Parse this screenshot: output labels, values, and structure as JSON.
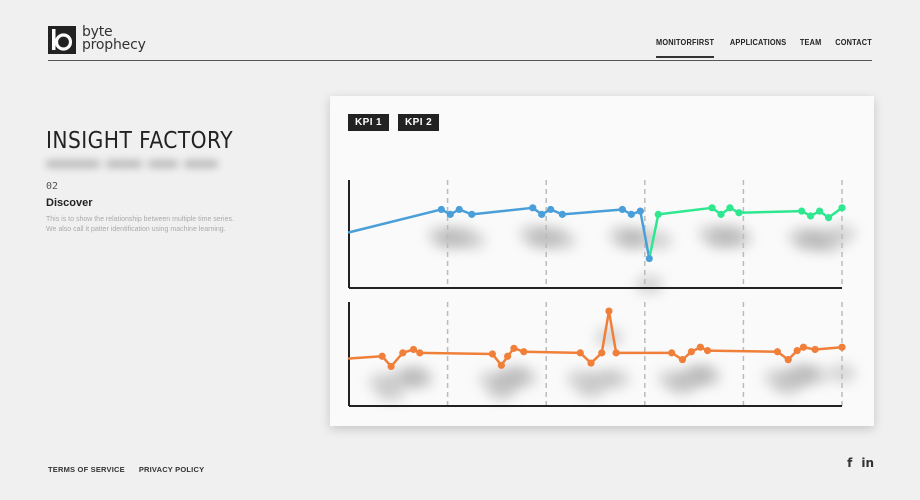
{
  "brand": {
    "line1": "byte",
    "line2": "prophecy"
  },
  "nav": [
    {
      "label": "MONITORFIRST",
      "active": true
    },
    {
      "label": "APPLICATIONS",
      "active": false
    },
    {
      "label": "TEAM",
      "active": false
    },
    {
      "label": "CONTACT",
      "active": false
    }
  ],
  "hero": {
    "title": "INSIGHT FACTORY",
    "step_number": "02",
    "step_title": "Discover",
    "step_description": "This is to show the relationship between multiple time series. We also call it patter identification using machine learning."
  },
  "kpi_tabs": [
    "KPI 1",
    "KPI 2"
  ],
  "footer": {
    "links": [
      "TERMS OF SERVICE",
      "PRIVACY POLICY"
    ]
  },
  "social": [
    {
      "icon": "facebook-icon",
      "glyph": "f"
    },
    {
      "icon": "linkedin-icon",
      "glyph": "in"
    }
  ],
  "colors": {
    "kpi1_part1": "#4a9fd8",
    "kpi1_part2": "#2ee88f",
    "kpi2": "#f07f3a",
    "axis": "#222",
    "gridline": "#bbb"
  },
  "chart_data": [
    {
      "type": "line",
      "name": "KPI 1",
      "x": [
        0,
        1.03,
        1.13,
        1.23,
        1.37,
        2.05,
        2.15,
        2.25,
        2.38,
        3.05,
        3.15,
        3.25,
        3.35,
        3.45,
        4.05,
        4.15,
        4.25,
        4.35,
        5.05,
        5.15,
        5.25,
        5.35,
        5.5
      ],
      "values": [
        0.8,
        2.2,
        1.9,
        2.2,
        1.9,
        2.3,
        1.9,
        2.2,
        1.9,
        2.2,
        1.9,
        2.1,
        -0.8,
        1.9,
        2.3,
        1.9,
        2.3,
        2.0,
        2.1,
        1.8,
        2.1,
        1.7,
        2.3
      ],
      "color_split_index": 13,
      "ylim": [
        -2.6,
        4.0
      ],
      "xlim": [
        0,
        5.5
      ],
      "grid_x": [
        1.1,
        2.2,
        3.3,
        4.4,
        5.5
      ],
      "grid": true
    },
    {
      "type": "line",
      "name": "KPI 2",
      "x": [
        0,
        0.37,
        0.47,
        0.6,
        0.72,
        0.79,
        1.6,
        1.7,
        1.77,
        1.84,
        1.95,
        2.58,
        2.7,
        2.82,
        2.9,
        2.98,
        3.6,
        3.72,
        3.82,
        3.92,
        4.0,
        4.78,
        4.9,
        5.0,
        5.07,
        5.2,
        5.5
      ],
      "values": [
        1.0,
        1.2,
        0.3,
        1.5,
        1.8,
        1.5,
        1.4,
        0.4,
        1.2,
        1.9,
        1.6,
        1.5,
        0.6,
        1.5,
        5.2,
        1.5,
        1.5,
        0.9,
        1.6,
        2.0,
        1.7,
        1.6,
        0.9,
        1.7,
        2.0,
        1.8,
        2.0
      ],
      "ylim": [
        -3.2,
        6.0
      ],
      "xlim": [
        0,
        5.5
      ],
      "grid_x": [
        1.1,
        2.2,
        3.3,
        4.4,
        5.5
      ],
      "grid": true
    }
  ]
}
